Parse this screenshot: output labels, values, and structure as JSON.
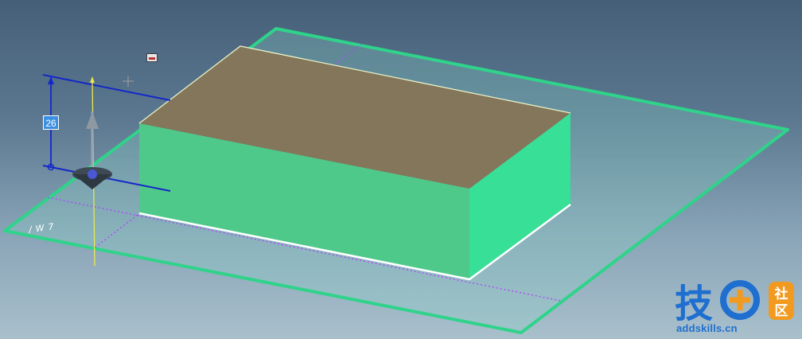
{
  "dimension": {
    "value": "26"
  },
  "plane_label": "/W7",
  "watermark": {
    "char1": "技",
    "badge_top": "社",
    "badge_bottom": "区",
    "site": "addskills.cn"
  },
  "colors": {
    "background_top": "#465f78",
    "background_bottom": "#a9c0cc",
    "plane_edge": "#2fd38a",
    "box_side": "#3fd996",
    "box_top": "#83765a",
    "dimension_line": "#1428c8",
    "axis": "#e8e850",
    "reference_dotted": "#b040ff",
    "watermark_blue": "#1e6fd0",
    "watermark_orange": "#f29a1f"
  },
  "icons": {
    "move_handle": "triad-move-handle-icon",
    "cursor": "crosshair-cursor-icon",
    "widget": "toolbar-widget-icon"
  }
}
